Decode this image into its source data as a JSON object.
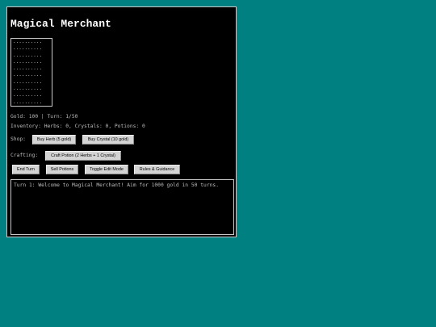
{
  "game": {
    "title": "Magical Merchant",
    "map_grid": "..........\n..........\n..........\n..........\n..........\n..........\n..........\n..........\n..........\n..........",
    "status_line": "Gold: 100 | Turn: 1/50",
    "inventory_line": "Inventory: Herbs: 0, Crystals: 0, Potions: 0",
    "shop_label": "Shop:",
    "buy_herb_label": "Buy Herb (5 gold)",
    "buy_crystal_label": "Buy Crystal (10 gold)",
    "crafting_label": "Crafting:",
    "craft_potion_label": "Craft Potion (2 Herbs + 1 Crystal)",
    "end_turn_label": "End Turn",
    "sell_potions_label": "Sell Potions",
    "toggle_edit_label": "Toggle Edit Mode",
    "rules_label": "Rules & Guidance",
    "log_text": "Turn 1: Welcome to Magical Merchant! Aim for 1000 gold in 50 turns."
  },
  "colors": {
    "desktop": "#008080",
    "window": "#000000",
    "button": "#d4d4d4"
  }
}
